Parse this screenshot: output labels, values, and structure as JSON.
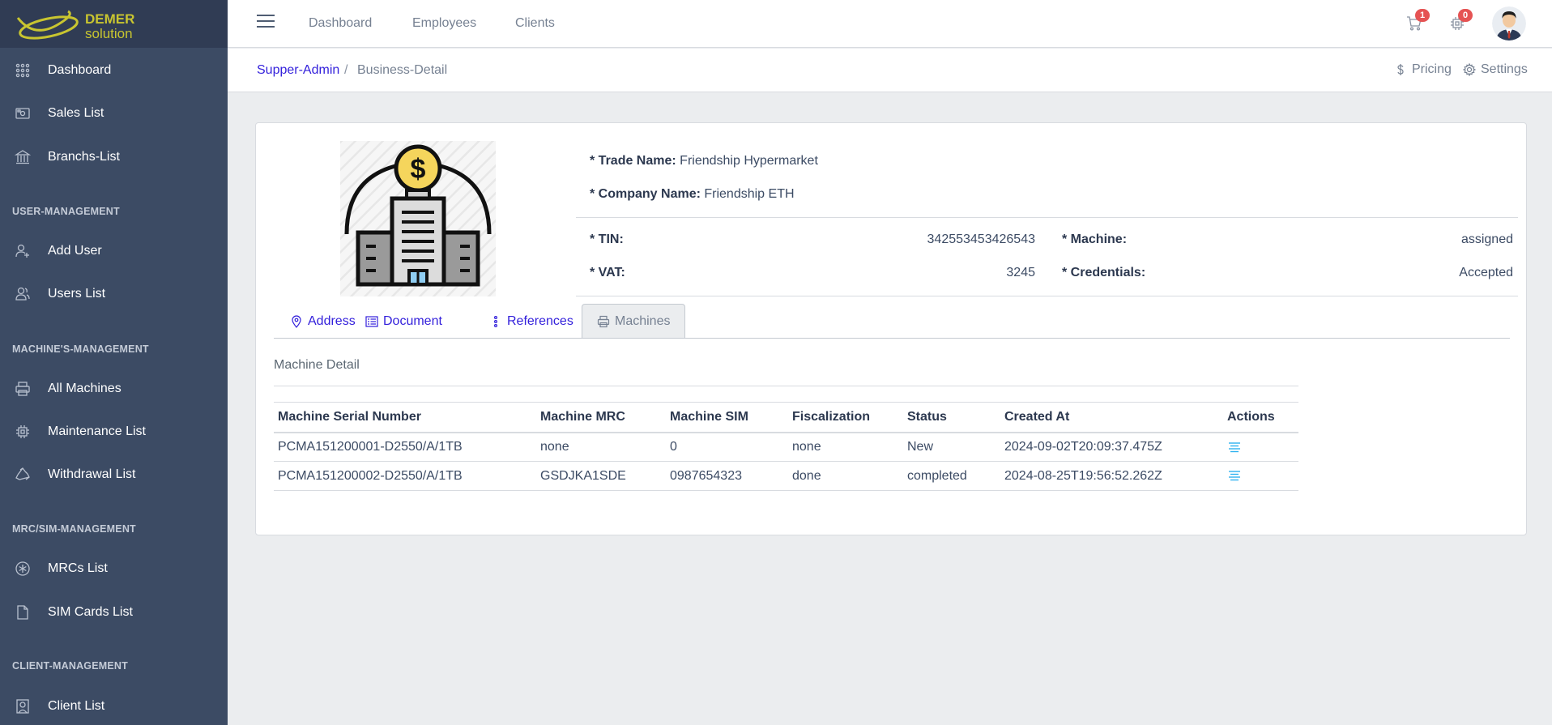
{
  "brand": {
    "line1": "DEMER",
    "line2": "solution",
    "accent": "#c8c530"
  },
  "sidebar": {
    "items": [
      {
        "label": "Dashboard",
        "icon": "grid-dots-icon"
      },
      {
        "label": "Sales List",
        "icon": "cash-icon"
      },
      {
        "label": "Branchs-List",
        "icon": "bank-icon"
      },
      {
        "label": "Add User",
        "icon": "user-plus-icon"
      },
      {
        "label": "Users List",
        "icon": "users-icon"
      },
      {
        "label": "All Machines",
        "icon": "printer-icon"
      },
      {
        "label": "Maintenance List",
        "icon": "chip-icon"
      },
      {
        "label": "Withdrawal List",
        "icon": "recycle-icon"
      },
      {
        "label": "MRCs List",
        "icon": "asterisk-icon"
      },
      {
        "label": "SIM Cards List",
        "icon": "file-icon"
      },
      {
        "label": "Client List",
        "icon": "portrait-icon"
      }
    ],
    "sections": {
      "user": "USER-MANAGEMENT",
      "machine": "MACHINE'S-MANAGEMENT",
      "mrc": "MRC/SIM-MANAGEMENT",
      "client": "CLIENT-MANAGEMENT"
    }
  },
  "header": {
    "nav": [
      "Dashboard",
      "Employees",
      "Clients"
    ],
    "cart_badge": "1",
    "chip_badge": "0"
  },
  "breadcrumb": {
    "root": "Supper-Admin",
    "sep": "/",
    "current": "Business-Detail"
  },
  "subheader": {
    "pricing": "Pricing",
    "settings": "Settings"
  },
  "business": {
    "trade_name_label": "* Trade Name:",
    "trade_name": "Friendship Hypermarket",
    "company_name_label": "* Company Name:",
    "company_name": "Friendship ETH",
    "tin_label": "* TIN:",
    "tin": "342553453426543",
    "vat_label": "* VAT:",
    "vat": "3245",
    "machine_label": "* Machine:",
    "machine": "assigned",
    "credentials_label": "* Credentials:",
    "credentials": "Accepted"
  },
  "tabs": [
    {
      "label": "Address",
      "icon": "location-pin-icon"
    },
    {
      "label": "Document",
      "icon": "document-list-icon"
    },
    {
      "label": "References",
      "icon": "options-vertical-icon"
    },
    {
      "label": "Machines",
      "icon": "printer-icon",
      "active": true
    }
  ],
  "machines": {
    "title": "Machine Detail",
    "columns": [
      "Machine Serial Number",
      "Machine MRC",
      "Machine SIM",
      "Fiscalization",
      "Status",
      "Created At",
      "Actions"
    ],
    "rows": [
      [
        "PCMA151200001-D2550/A/1TB",
        "none",
        "0",
        "none",
        "New",
        "2024-09-02T20:09:37.475Z"
      ],
      [
        "PCMA151200002-D2550/A/1TB",
        "GSDJKA1SDE",
        "0987654323",
        "done",
        "completed",
        "2024-08-25T19:56:52.262Z"
      ]
    ]
  }
}
